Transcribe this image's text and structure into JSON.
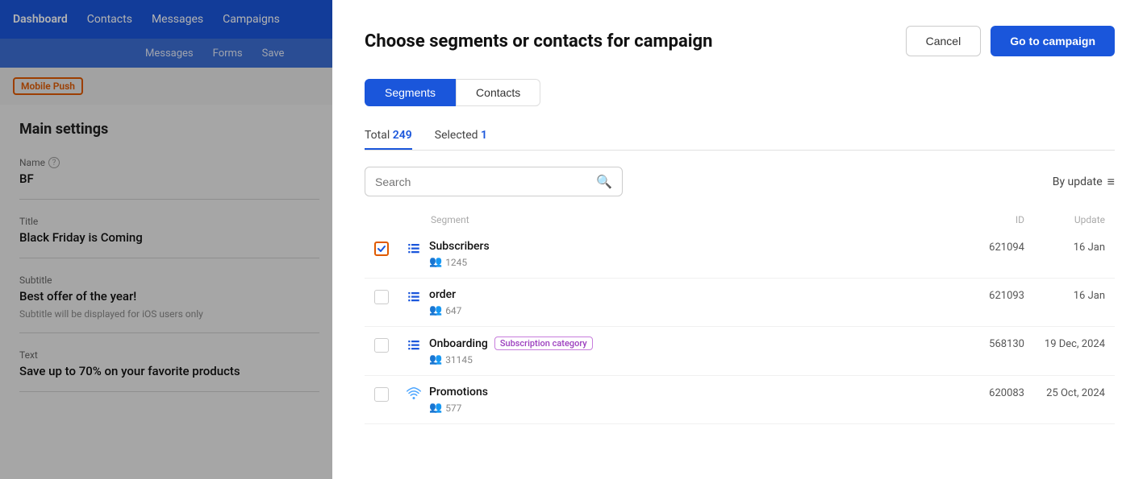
{
  "nav": {
    "items": [
      "Dashboard",
      "Contacts",
      "Messages",
      "Campaigns"
    ],
    "sub_items": [
      "Messages",
      "Forms",
      "Save"
    ]
  },
  "left_panel": {
    "badge": "Mobile Push",
    "main_settings": "Main settings",
    "fields": [
      {
        "label": "Name",
        "value": "BF",
        "has_icon": true
      },
      {
        "label": "Title",
        "value": "Black Friday is Coming"
      },
      {
        "label": "Subtitle",
        "value": "Best offer of the year!",
        "note": "Subtitle will be displayed for iOS users only"
      },
      {
        "label": "Text",
        "value": "Save up to 70% on your favorite products"
      }
    ]
  },
  "modal": {
    "title": "Choose segments or contacts for campaign",
    "cancel_label": "Cancel",
    "go_label": "Go to campaign",
    "tabs": [
      "Segments",
      "Contacts"
    ],
    "active_tab": "Segments",
    "counts": [
      {
        "label": "Total",
        "count": "249"
      },
      {
        "label": "Selected",
        "count": "1"
      }
    ],
    "search_placeholder": "Search",
    "sort_label": "By update",
    "columns": {
      "segment": "Segment",
      "id": "ID",
      "update": "Update"
    },
    "segments": [
      {
        "name": "Subscribers",
        "count": "1245",
        "id": "621094",
        "update": "16 Jan",
        "selected": true,
        "badge": null,
        "icon_type": "list"
      },
      {
        "name": "order",
        "count": "647",
        "id": "621093",
        "update": "16 Jan",
        "selected": false,
        "badge": null,
        "icon_type": "list"
      },
      {
        "name": "Onboarding",
        "count": "31145",
        "id": "568130",
        "update": "19 Dec, 2024",
        "selected": false,
        "badge": "Subscription category",
        "icon_type": "list"
      },
      {
        "name": "Promotions",
        "count": "577",
        "id": "620083",
        "update": "25 Oct, 2024",
        "selected": false,
        "badge": null,
        "icon_type": "wifi"
      }
    ]
  }
}
